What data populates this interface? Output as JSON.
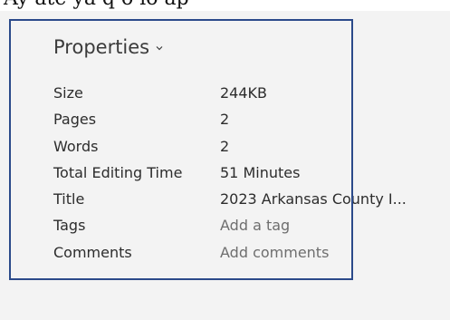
{
  "top_strip": {
    "text": "Ay ate ya q o lo ap"
  },
  "properties": {
    "heading": "Properties",
    "rows": [
      {
        "label": "Size",
        "value": "244KB"
      },
      {
        "label": "Pages",
        "value": "2"
      },
      {
        "label": "Words",
        "value": "2"
      },
      {
        "label": "Total Editing Time",
        "value": "51 Minutes"
      },
      {
        "label": "Title",
        "value": "2023 Arkansas County I..."
      },
      {
        "label": "Tags",
        "value": "Add a tag"
      },
      {
        "label": "Comments",
        "value": "Add comments"
      }
    ]
  }
}
